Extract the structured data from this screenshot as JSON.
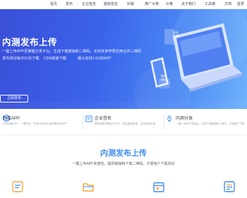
{
  "nav": {
    "items": [
      "首页",
      "发布",
      "企业签名",
      "超级签名",
      "封装",
      "推广大使",
      "价格",
      "关于我们",
      "工具箱",
      "文档"
    ],
    "login": "登录"
  },
  "hero": {
    "title": "内测发布上传",
    "line1": "一键上传APP至掌握分发平台，生成下载链接和二维码，支持安卓苹果应用合并二维码",
    "line2a": "发布测试每日10次下载",
    "line2b": "CDN高速下载",
    "line2c": "最大支持1.5G的APP",
    "button": "立即发布",
    "tags": {
      "auto_publish": "自动发布",
      "simulate": "模拟测试"
    }
  },
  "features": [
    {
      "title": "封装APP",
      "desc": "在线封装APP，一键打包，支持H5网页生成苹果安卓APP",
      "icon": "package-icon"
    },
    {
      "title": "企业签名",
      "desc": "提供超级苹果企业证书，签名稳定快速，支持各类应用",
      "icon": "certificate-icon"
    },
    {
      "title": "内测分发",
      "desc": "一键上传APP安装包，生成下载链接和二维码，方便用户下载",
      "icon": "rocket-icon"
    }
  ],
  "section": {
    "title": "内测发布上传",
    "subtitle": "一键上传APP安装包，提供链接和下载二维码，方便用户下载测试"
  },
  "colors": {
    "accent": "#2f6fe8",
    "hero_start": "#3b4fd8",
    "hero_end": "#6fb2fb",
    "section_title": "#3d8cf0"
  },
  "icons": [
    "document-icon",
    "folder-icon",
    "calendar-icon",
    "list-icon"
  ]
}
